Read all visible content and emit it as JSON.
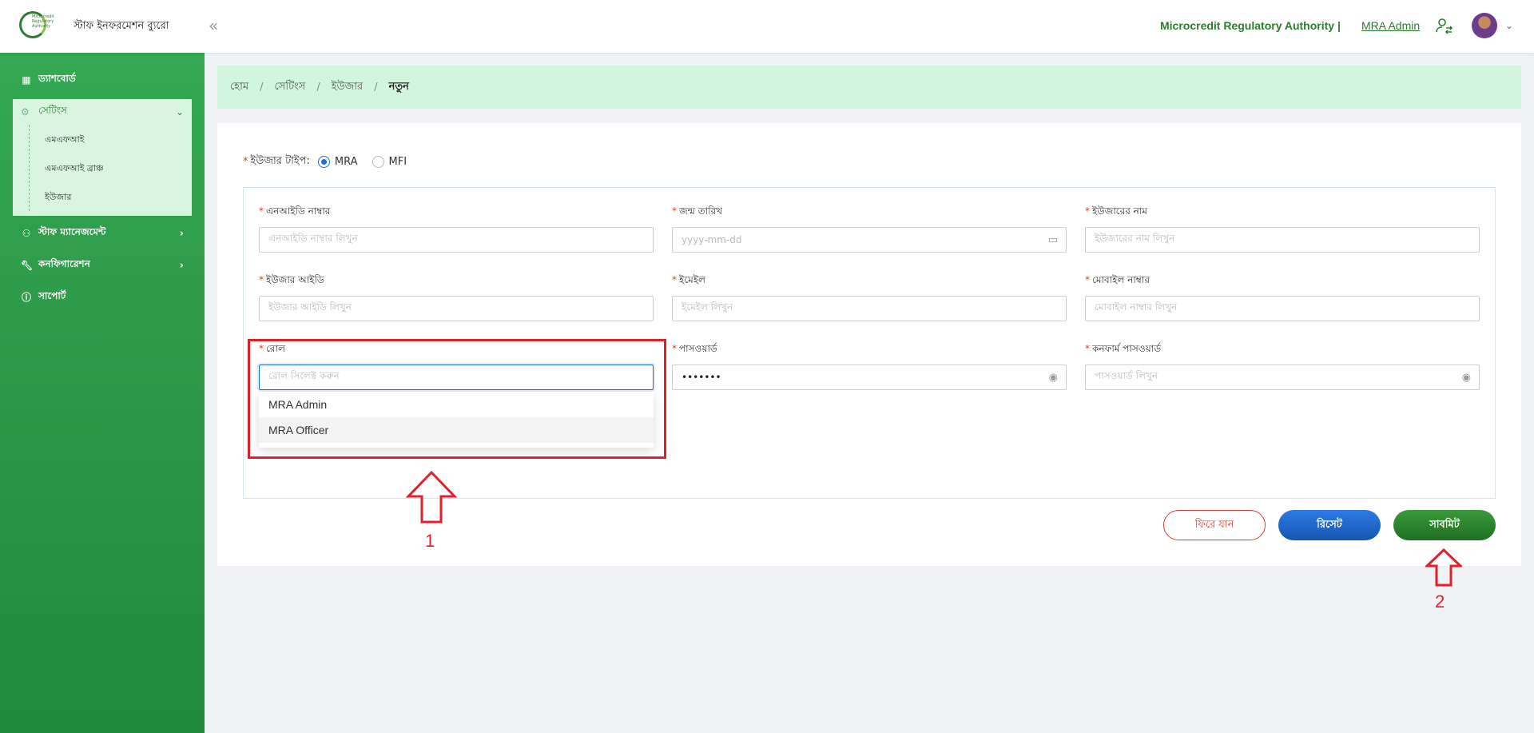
{
  "header": {
    "logo_text": "Microcredit Regulatory Authority",
    "brand": "স্টাফ ইনফরমেশন ব্যুরো",
    "collapse_icon": "«",
    "org_name": "Microcredit Regulatory Authority |",
    "user_name": "MRA Admin"
  },
  "sidebar": {
    "items": [
      {
        "label": "ড্যাশবোর্ড",
        "icon": "dashboard-icon"
      },
      {
        "label": "স্টাফ ম্যানেজমেন্ট",
        "icon": "users-icon"
      },
      {
        "label": "কনফিগারেশন",
        "icon": "wrench-icon"
      },
      {
        "label": "সাপোর্ট",
        "icon": "info-icon"
      }
    ],
    "settings": {
      "label": "সেটিংস",
      "subitems": [
        "এমএফআই",
        "এমএফআই ব্রাঞ্চ",
        "ইউজার"
      ]
    }
  },
  "breadcrumb": {
    "home": "হোম",
    "settings": "সেটিংস",
    "user": "ইউজার",
    "current": "নতুন",
    "sep": "/"
  },
  "form": {
    "user_type_label": "ইউজার টাইপ:",
    "user_type_options": [
      "MRA",
      "MFI"
    ],
    "user_type_selected": "MRA",
    "required_mark": "*",
    "nid_label": "এনআইডি নাম্বার",
    "nid_placeholder": "এনআইডি নাম্বার লিখুন",
    "dob_label": "জন্ম তারিখ",
    "dob_placeholder": "yyyy-mm-dd",
    "username_label": "ইউজারের নাম",
    "username_placeholder": "ইউজারের নাম লিখুন",
    "userid_label": "ইউজার আইডি",
    "userid_placeholder": "ইউজার আইডি লিখুন",
    "email_label": "ইমেইল",
    "email_placeholder": "ইমেইল লিখুন",
    "mobile_label": "মোবাইল নাম্বার",
    "mobile_placeholder": "মোবাইল নাম্বার লিখুন",
    "role_label": "রোল",
    "role_placeholder": "রোল সিলেক্ট করুন",
    "password_label": "পাসওয়ার্ড",
    "password_value": "•••••••",
    "confirm_label": "কনফার্ম পাসওয়ার্ড",
    "confirm_placeholder": "পাসওয়ার্ড লিখুন",
    "role_options": [
      "MRA Admin",
      "MRA Officer"
    ]
  },
  "buttons": {
    "back": "ফিরে যান",
    "reset": "রিসেট",
    "submit": "সাবমিট"
  },
  "annotations": {
    "one": "1",
    "two": "2",
    "color": "#e0202a"
  },
  "colors": {
    "primary_green": "#2e7d32",
    "sidebar_green": "#34a853",
    "breadcrumb_bg": "#d2f5de",
    "reset_blue": "#1557b0"
  }
}
